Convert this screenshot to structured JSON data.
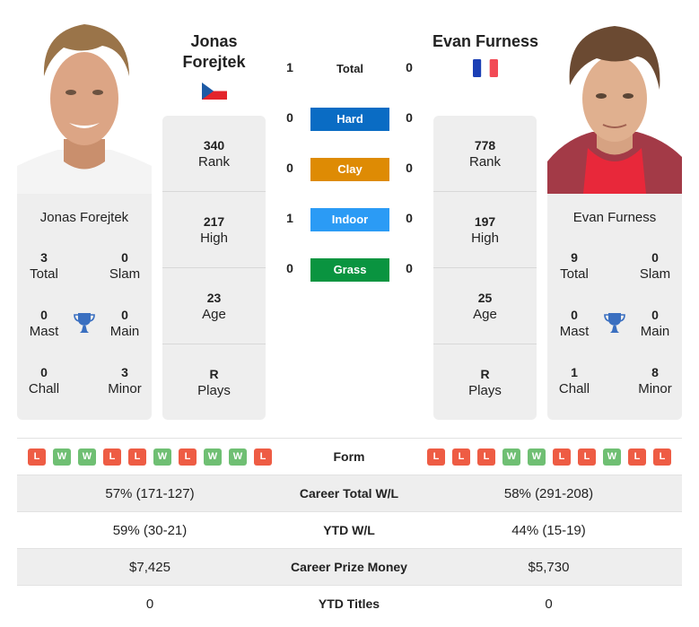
{
  "colors": {
    "hard": "#0a6cc4",
    "clay": "#de8b04",
    "indoor": "#2b9bf5",
    "grass": "#0a9440",
    "win": "#6fbf73",
    "loss": "#ee5c44",
    "card_bg": "#eeeeee",
    "trophy": "#3a6fc0"
  },
  "player1": {
    "name": "Jonas Forejtek",
    "name_line1": "Jonas",
    "name_line2": "Forejtek",
    "flag": "czech-republic-flag",
    "titles": {
      "total": "3",
      "total_label": "Total",
      "slam": "0",
      "slam_label": "Slam",
      "mast": "0",
      "mast_label": "Mast",
      "main": "0",
      "main_label": "Main",
      "chall": "0",
      "chall_label": "Chall",
      "minor": "3",
      "minor_label": "Minor"
    },
    "stats": {
      "rank": "340",
      "rank_label": "Rank",
      "high": "217",
      "high_label": "High",
      "age": "23",
      "age_label": "Age",
      "plays": "R",
      "plays_label": "Plays"
    },
    "form": [
      "L",
      "W",
      "W",
      "L",
      "L",
      "W",
      "L",
      "W",
      "W",
      "L"
    ]
  },
  "player2": {
    "name": "Evan Furness",
    "flag": "france-flag",
    "titles": {
      "total": "9",
      "total_label": "Total",
      "slam": "0",
      "slam_label": "Slam",
      "mast": "0",
      "mast_label": "Mast",
      "main": "0",
      "main_label": "Main",
      "chall": "1",
      "chall_label": "Chall",
      "minor": "8",
      "minor_label": "Minor"
    },
    "stats": {
      "rank": "778",
      "rank_label": "Rank",
      "high": "197",
      "high_label": "High",
      "age": "25",
      "age_label": "Age",
      "plays": "R",
      "plays_label": "Plays"
    },
    "form": [
      "L",
      "L",
      "L",
      "W",
      "W",
      "L",
      "L",
      "W",
      "L",
      "L"
    ]
  },
  "h2h": [
    {
      "label": "Total",
      "p1": "1",
      "p2": "0"
    },
    {
      "label": "Hard",
      "p1": "0",
      "p2": "0"
    },
    {
      "label": "Clay",
      "p1": "0",
      "p2": "0"
    },
    {
      "label": "Indoor",
      "p1": "1",
      "p2": "0"
    },
    {
      "label": "Grass",
      "p1": "0",
      "p2": "0"
    }
  ],
  "comparison": {
    "form_label": "Form",
    "rows": [
      {
        "label": "Career Total W/L",
        "p1": "57% (171-127)",
        "p2": "58% (291-208)"
      },
      {
        "label": "YTD W/L",
        "p1": "59% (30-21)",
        "p2": "44% (15-19)"
      },
      {
        "label": "Career Prize Money",
        "p1": "$7,425",
        "p2": "$5,730"
      },
      {
        "label": "YTD Titles",
        "p1": "0",
        "p2": "0"
      }
    ]
  }
}
